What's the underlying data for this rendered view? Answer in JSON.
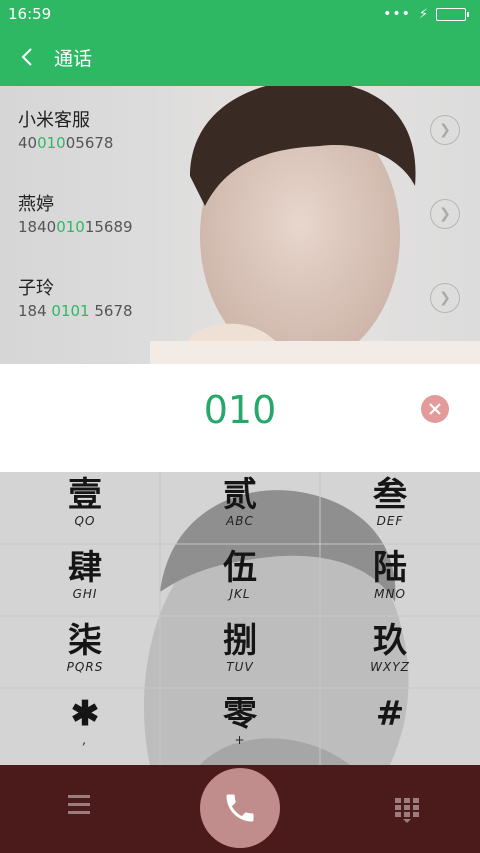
{
  "status": {
    "time": "16:59"
  },
  "header": {
    "title": "通话"
  },
  "contacts": [
    {
      "name": "小米客服",
      "num_pre": "40",
      "num_match": "010",
      "num_post": "05678"
    },
    {
      "name": "燕婷",
      "num_pre": "1840",
      "num_match": "010",
      "num_post": "15689"
    },
    {
      "name": "子玲",
      "num_pre": "184 ",
      "num_match": "0101",
      "num_post": " 5678"
    }
  ],
  "dialer": {
    "number": "010"
  },
  "keys": [
    {
      "glyph": "壹",
      "letters": "QO"
    },
    {
      "glyph": "贰",
      "letters": "ABC"
    },
    {
      "glyph": "叁",
      "letters": "DEF"
    },
    {
      "glyph": "肆",
      "letters": "GHI"
    },
    {
      "glyph": "伍",
      "letters": "JKL"
    },
    {
      "glyph": "陆",
      "letters": "MNO"
    },
    {
      "glyph": "柒",
      "letters": "PQRS"
    },
    {
      "glyph": "捌",
      "letters": "TUV"
    },
    {
      "glyph": "玖",
      "letters": "WXYZ"
    },
    {
      "glyph": "✱",
      "letters": ","
    },
    {
      "glyph": "零",
      "letters": "+"
    },
    {
      "glyph": "#",
      "letters": ""
    }
  ],
  "colors": {
    "accent": "#2fb864",
    "bottom_bar": "#4b1b1b",
    "call_button": "#c08c8c"
  }
}
